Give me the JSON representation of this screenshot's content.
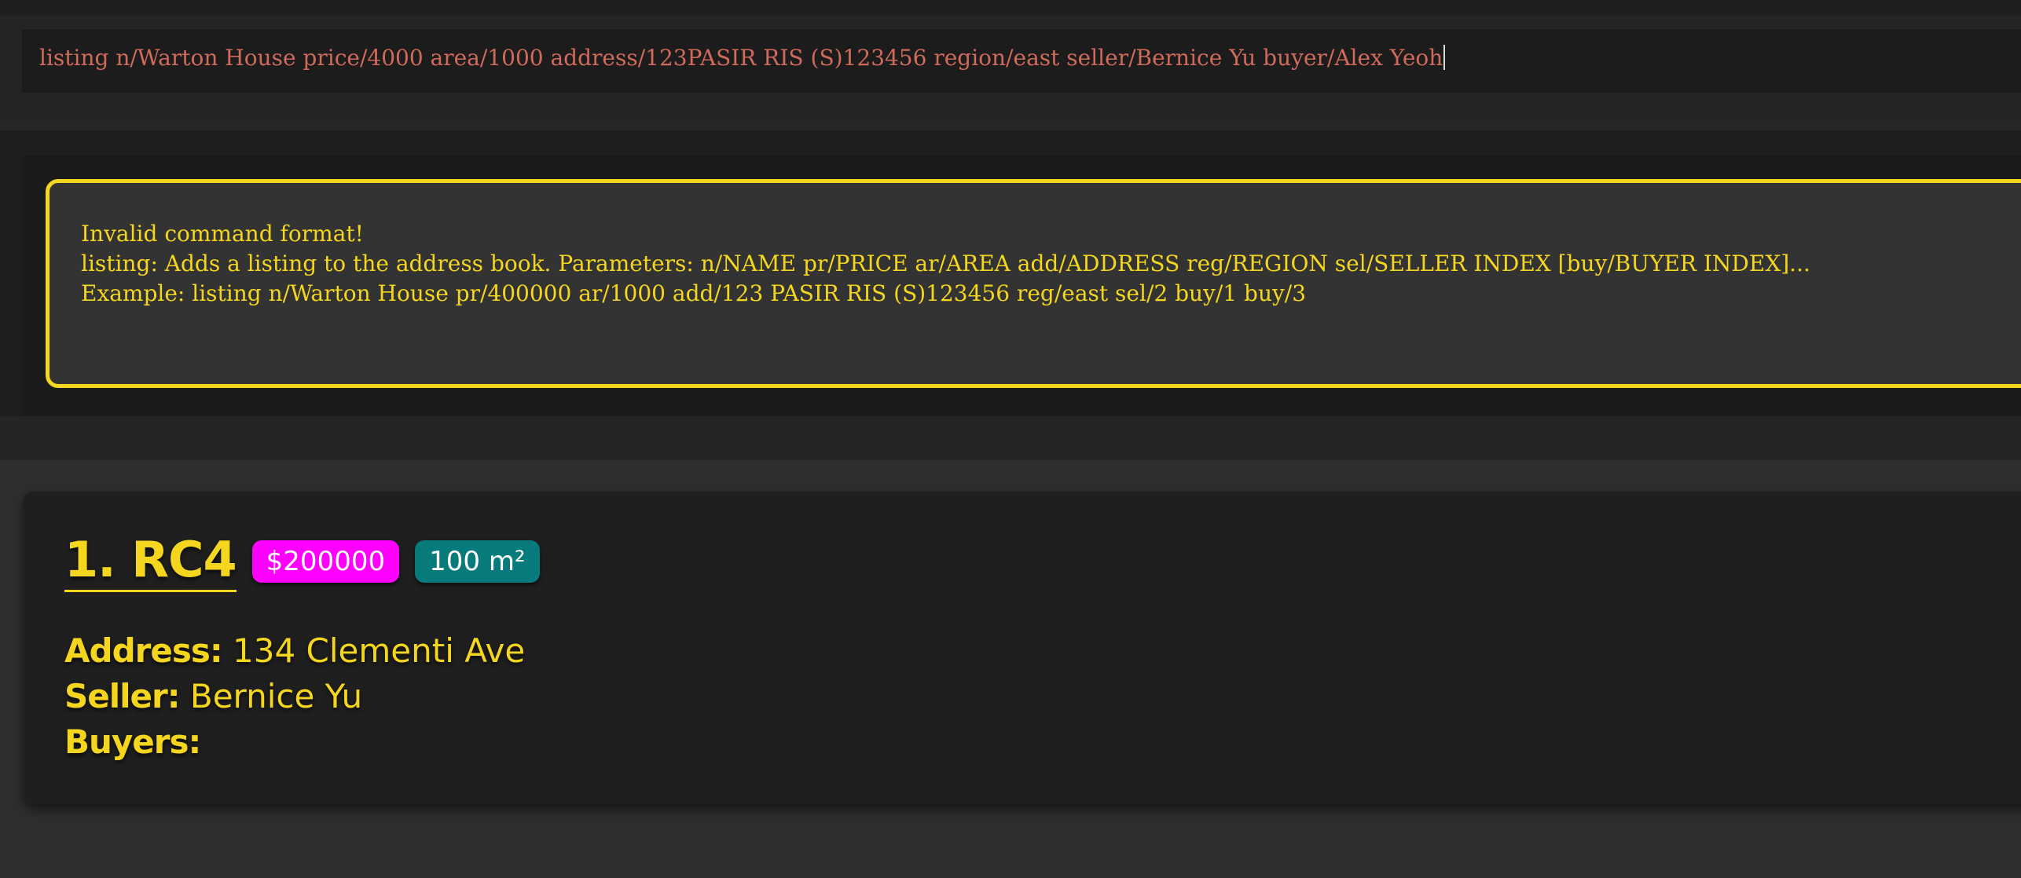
{
  "command_box": {
    "text": "listing n/Warton House price/4000 area/1000 address/123PASIR RIS (S)123456 region/east seller/Bernice Yu buyer/Alex Yeoh"
  },
  "result_display": {
    "lines": [
      "Invalid command format!",
      "listing: Adds a listing to the address book. Parameters: n/NAME pr/PRICE ar/AREA add/ADDRESS reg/REGION sel/SELLER INDEX [buy/BUYER INDEX]...",
      "Example: listing n/Warton House pr/400000 ar/1000 add/123 PASIR RIS (S)123456 reg/east sel/2 buy/1 buy/3"
    ]
  },
  "listings": [
    {
      "index_name": "1.  RC4",
      "price": "$200000",
      "area": "100 m²",
      "address_label": "Address:",
      "address": "134 Clementi Ave",
      "seller_label": "Seller:",
      "seller": "Bernice Yu",
      "buyers_label": "Buyers:",
      "buyers": ""
    }
  ],
  "colors": {
    "accent": "#f5d61e",
    "command_text": "#d06a5b",
    "price_tag": "#ff00ff",
    "area_tag": "#077b7b",
    "background": "#2e2e2e"
  }
}
